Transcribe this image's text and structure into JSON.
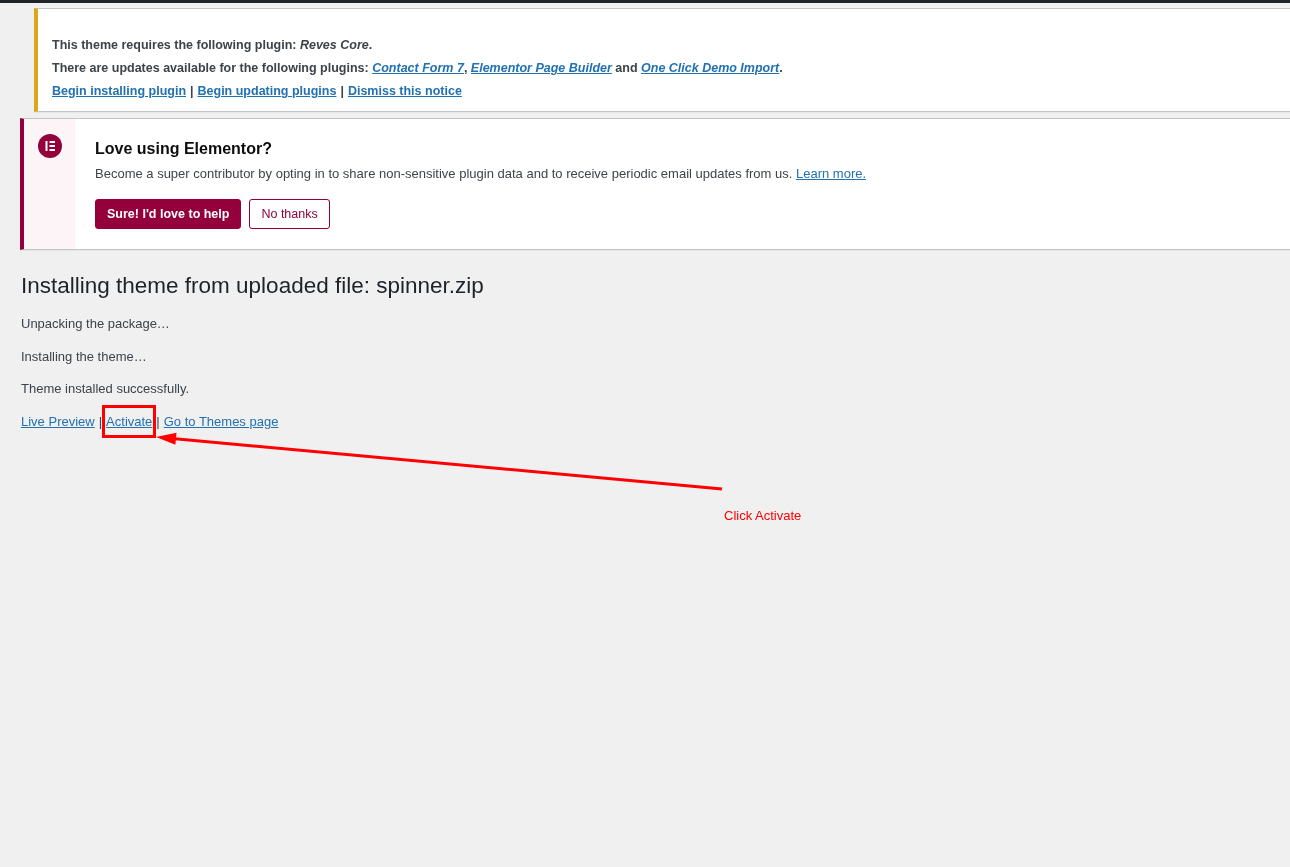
{
  "plugin_notice": {
    "kind": "warning",
    "required_line": "This theme requires the following plugin: *Reves Core*.",
    "updates_line": [
      {
        "kind": "text",
        "text": "There are updates available for the following plugins: "
      },
      {
        "kind": "link",
        "text": "Contact Form 7"
      },
      {
        "kind": "text",
        "text": ", "
      },
      {
        "kind": "link",
        "text": "Elementor Page Builder"
      },
      {
        "kind": "text",
        "text": " and "
      },
      {
        "kind": "link",
        "text": "One Click Demo Import"
      },
      {
        "kind": "text",
        "text": "."
      }
    ],
    "actions": [
      {
        "label": "Begin installing plugin"
      },
      {
        "label": "Begin updating plugins"
      },
      {
        "label": "Dismiss this notice"
      }
    ],
    "separator": "|"
  },
  "elementor_notice": {
    "kind": "brand",
    "title": "Love using Elementor?",
    "description": "Become a super contributor by opting in to share non-sensitive plugin data and to receive periodic email updates from us.",
    "link": "Learn more.",
    "buttons": [
      {
        "label": "Sure! I'd love to help",
        "kind": "primary"
      },
      {
        "label": "No thanks",
        "kind": "secondary"
      }
    ]
  },
  "install": {
    "title": "Installing theme from uploaded file: spinner.zip",
    "messages": [
      "Unpacking the package…",
      "Installing the theme…",
      "Theme installed successfully."
    ],
    "actions": [
      {
        "label": "Live Preview",
        "highlighted": false
      },
      {
        "label": "Activate",
        "highlighted": true
      },
      {
        "label": "Go to Themes page",
        "highlighted": false
      }
    ],
    "separator": "|"
  },
  "annotation": {
    "callout": "Click Activate"
  }
}
